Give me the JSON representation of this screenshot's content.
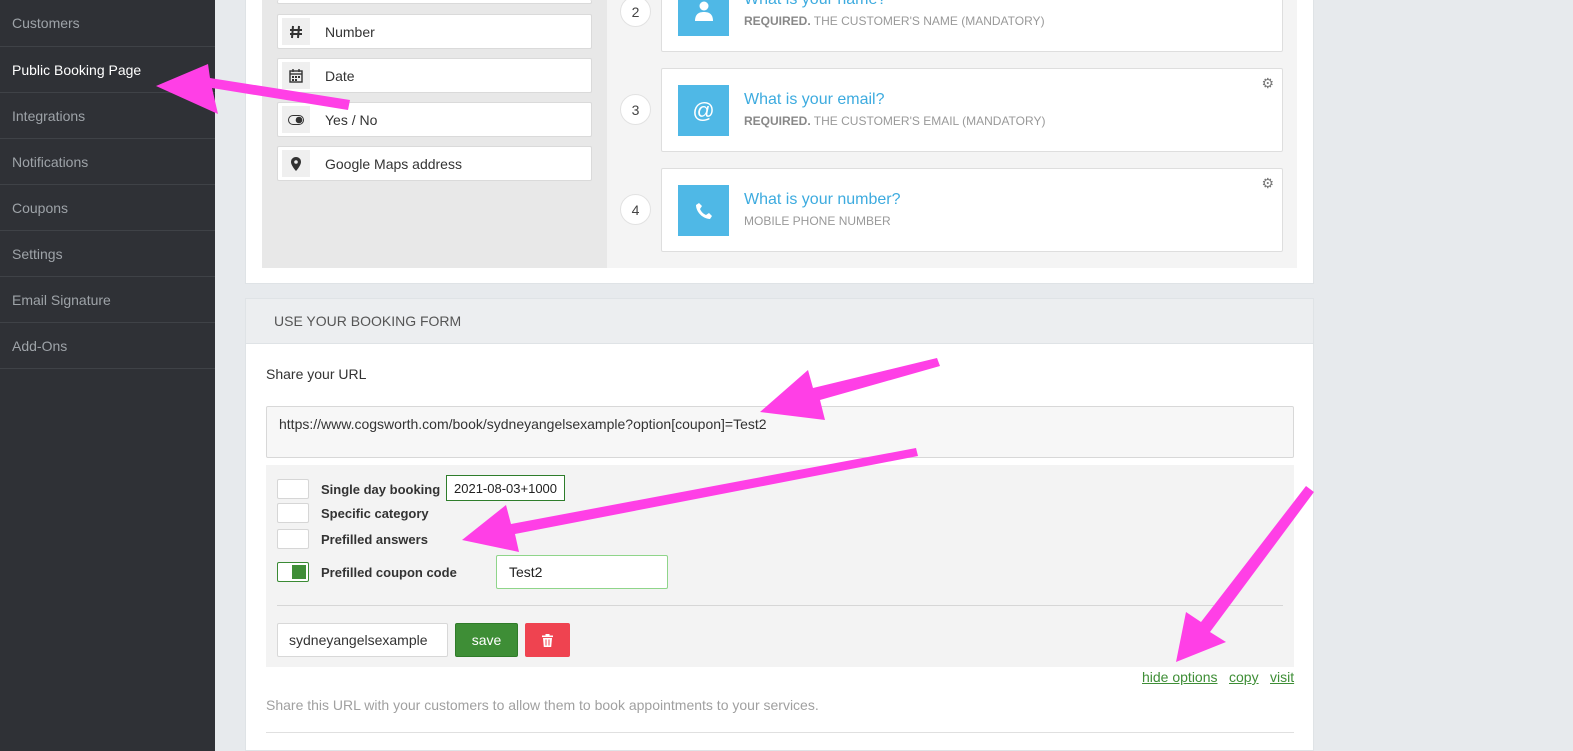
{
  "sidebar": {
    "items": [
      {
        "label": "Customers"
      },
      {
        "label": "Public Booking Page"
      },
      {
        "label": "Integrations"
      },
      {
        "label": "Notifications"
      },
      {
        "label": "Coupons"
      },
      {
        "label": "Settings"
      },
      {
        "label": "Email Signature"
      },
      {
        "label": "Add-Ons"
      }
    ]
  },
  "field_palette": {
    "items": [
      {
        "label": "Number",
        "icon": "hash-icon"
      },
      {
        "label": "Date",
        "icon": "calendar-icon"
      },
      {
        "label": "Yes / No",
        "icon": "toggle-icon"
      },
      {
        "label": "Google Maps address",
        "icon": "map-marker-icon"
      }
    ]
  },
  "questions": [
    {
      "number": "2",
      "title": "What is your name?",
      "sub_strong": "REQUIRED.",
      "sub": " THE CUSTOMER'S NAME (MANDATORY)",
      "icon": "user-icon"
    },
    {
      "number": "3",
      "title": "What is your email?",
      "sub_strong": "REQUIRED.",
      "sub": " THE CUSTOMER'S EMAIL (MANDATORY)",
      "icon": "at-icon"
    },
    {
      "number": "4",
      "title": "What is your number?",
      "sub_strong": "",
      "sub": "MOBILE PHONE NUMBER",
      "icon": "phone-icon"
    }
  ],
  "booking_form": {
    "heading": "USE YOUR BOOKING FORM",
    "share_label": "Share your URL",
    "url": "https://www.cogsworth.com/book/sydneyangelsexample?option[coupon]=Test2",
    "options": {
      "single_day": {
        "label": "Single day booking",
        "checked": false,
        "value": "2021-08-03+1000"
      },
      "specific_category": {
        "label": "Specific category",
        "checked": false
      },
      "prefilled_answers": {
        "label": "Prefilled answers",
        "checked": false
      },
      "prefilled_coupon": {
        "label": "Prefilled coupon code",
        "checked": true,
        "value": "Test2"
      }
    },
    "slug": "sydneyangelsexample",
    "save_label": "save",
    "links": {
      "hide_options": "hide options",
      "copy": "copy",
      "visit": "visit"
    },
    "help_text": "Share this URL with your customers to allow them to book appointments to your services."
  },
  "colors": {
    "accent": "#3dabdf",
    "save": "#3e8e36",
    "delete": "#ef4350",
    "annotation_arrow": "#ff3fe6"
  }
}
